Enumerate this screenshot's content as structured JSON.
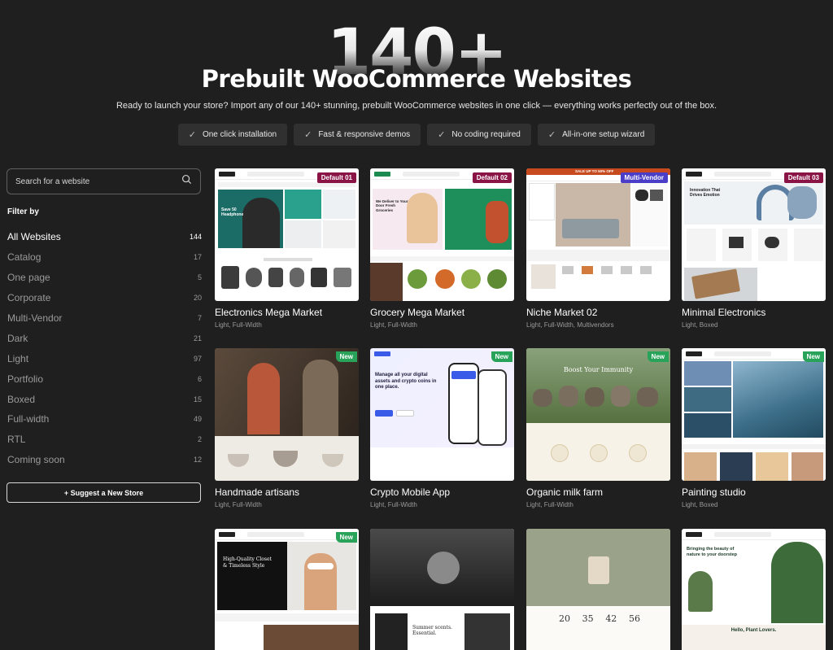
{
  "hero": {
    "big_number": "140+",
    "headline": "Prebuilt WooCommerce Websites",
    "subline": "Ready to launch your store? Import any of our 140+ stunning, prebuilt WooCommerce websites in one click — everything works perfectly out of the box.",
    "features": [
      "One click installation",
      "Fast & responsive demos",
      "No coding required",
      "All-in-one setup wizard"
    ]
  },
  "sidebar": {
    "search_placeholder": "Search for a website",
    "filter_title": "Filter by",
    "filters": [
      {
        "label": "All Websites",
        "count": "144",
        "active": true
      },
      {
        "label": "Catalog",
        "count": "17"
      },
      {
        "label": "One page",
        "count": "5"
      },
      {
        "label": "Corporate",
        "count": "20"
      },
      {
        "label": "Multi-Vendor",
        "count": "7"
      },
      {
        "label": "Dark",
        "count": "21"
      },
      {
        "label": "Light",
        "count": "97"
      },
      {
        "label": "Portfolio",
        "count": "6"
      },
      {
        "label": "Boxed",
        "count": "15"
      },
      {
        "label": "Full-width",
        "count": "49"
      },
      {
        "label": "RTL",
        "count": "2"
      },
      {
        "label": "Coming soon",
        "count": "12"
      }
    ],
    "suggest_label": "+ Suggest a New Store"
  },
  "cards": [
    {
      "title": "Electronics Mega Market",
      "tags": "Light, Full-Width",
      "badge": "Default 01"
    },
    {
      "title": "Grocery Mega Market",
      "tags": "Light, Full-Width",
      "badge": "Default 02"
    },
    {
      "title": "Niche Market 02",
      "tags": "Light, Full-Width, Multivendors",
      "badge": "Multi-Vendor"
    },
    {
      "title": "Minimal Electronics",
      "tags": "Light, Boxed",
      "badge": "Default 03"
    },
    {
      "title": "Handmade artisans",
      "tags": "Light, Full-Width",
      "badge": "New"
    },
    {
      "title": "Crypto Mobile App",
      "tags": "Light, Full-Width",
      "badge": "New"
    },
    {
      "title": "Organic milk farm",
      "tags": "Light, Full-Width",
      "badge": "New"
    },
    {
      "title": "Painting studio",
      "tags": "Light, Boxed",
      "badge": "New"
    },
    {
      "title": "",
      "tags": "",
      "badge": "New"
    },
    {
      "title": "",
      "tags": "",
      "badge": ""
    },
    {
      "title": "",
      "tags": "",
      "badge": ""
    },
    {
      "title": "",
      "tags": "",
      "badge": ""
    }
  ],
  "thumb_text": {
    "t1": [
      "Save 50 Headphone"
    ],
    "t2": [
      "We Deliver to Your Door Fresh Groceries"
    ],
    "t3": [
      "SALE UP TO 50% OFF"
    ],
    "t4": [
      "Innovation That Drives Emotion"
    ],
    "t6": [
      "Manage all your digital assets and crypto coins in one place."
    ],
    "t7": [
      "Boost Your Immunity"
    ],
    "t9": [
      "High-Quality Closet & Timeless Style"
    ],
    "t10": [
      "Summer scents. Essential."
    ],
    "t11": [
      "20",
      "35",
      "42",
      "56"
    ],
    "t12": [
      "Bringing the beauty of nature to your doorstep",
      "Hello, Plant Lovers."
    ]
  }
}
